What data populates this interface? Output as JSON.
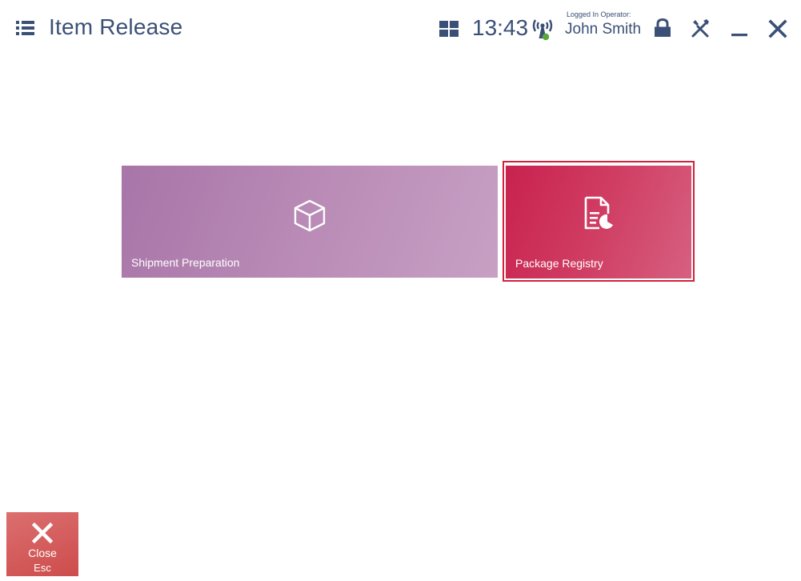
{
  "header": {
    "title": "Item Release",
    "clock": "13:43",
    "operator_caption": "Logged In Operator:",
    "operator_name": "John Smith"
  },
  "tiles": [
    {
      "label": "Shipment Preparation",
      "icon": "cube-icon",
      "color": "#b58ab3"
    },
    {
      "label": "Package Registry",
      "icon": "document-chart-icon",
      "color": "#cc2e59",
      "selected": true
    }
  ],
  "footer": {
    "close_label": "Close",
    "close_shortcut": "Esc"
  },
  "colors": {
    "header_text": "#3b5076",
    "selection_border": "#d0223d",
    "close_button": "#d45e5e",
    "signal_dot": "#5aa83a"
  }
}
